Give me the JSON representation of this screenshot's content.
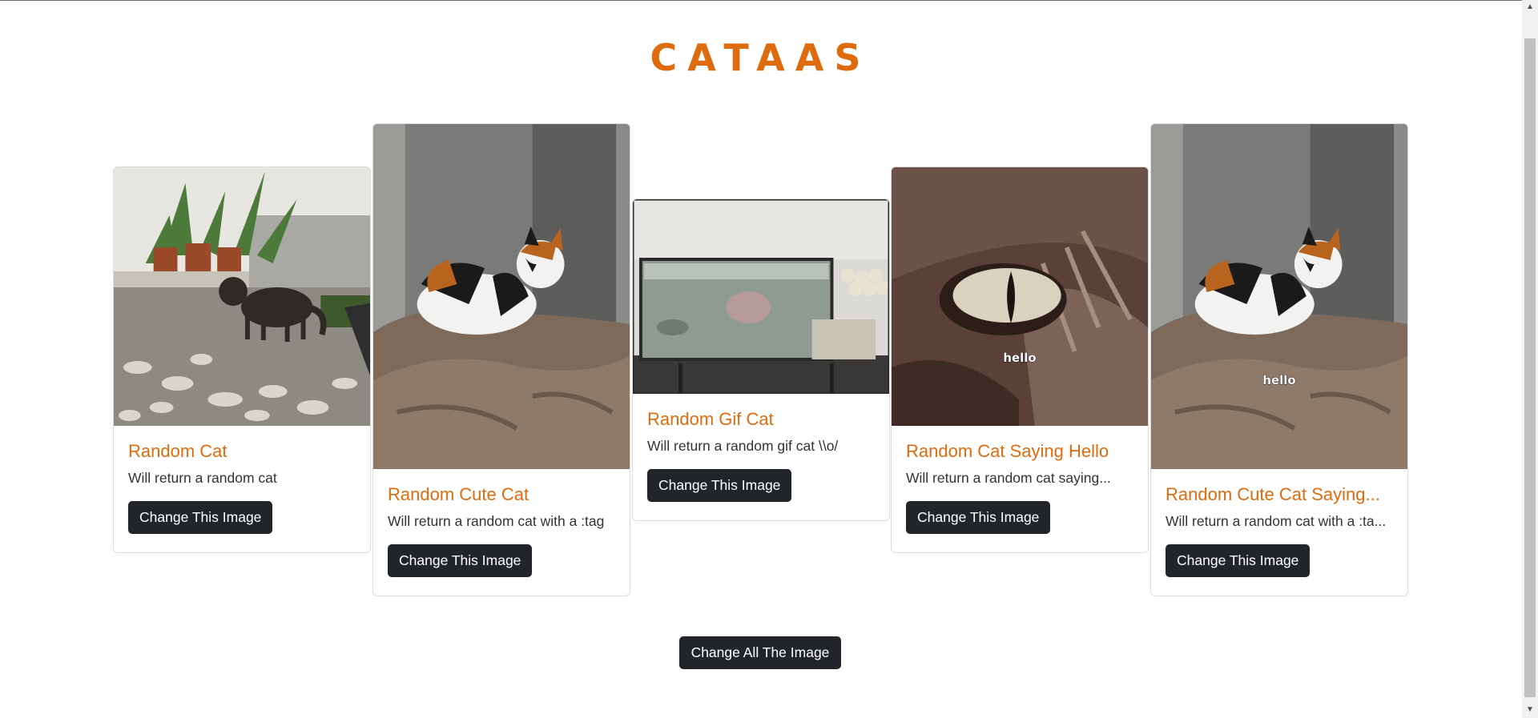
{
  "page": {
    "title": "CATAAS"
  },
  "cards": [
    {
      "title": "Random Cat",
      "text": "Will return a random cat",
      "button": "Change This Image",
      "image_icon": "cat-photo",
      "overlay_text": ""
    },
    {
      "title": "Random Cute Cat",
      "text": "Will return a random cat with a :tag",
      "button": "Change This Image",
      "image_icon": "cat-photo",
      "overlay_text": ""
    },
    {
      "title": "Random Gif Cat",
      "text": "Will return a random gif cat \\\\o/",
      "button": "Change This Image",
      "image_icon": "gif-photo",
      "overlay_text": ""
    },
    {
      "title": "Random Cat Saying Hello",
      "text": "Will return a random cat saying...",
      "button": "Change This Image",
      "image_icon": "cat-eye-photo",
      "overlay_text": "hello"
    },
    {
      "title": "Random Cute Cat Saying...",
      "text": "Will return a random cat with a :ta...",
      "button": "Change This Image",
      "image_icon": "cat-photo",
      "overlay_text": "hello"
    }
  ],
  "change_all_button": "Change All The Image",
  "colors": {
    "accent": "#de6b0d",
    "button_bg": "#212529",
    "button_text": "#ffffff"
  }
}
